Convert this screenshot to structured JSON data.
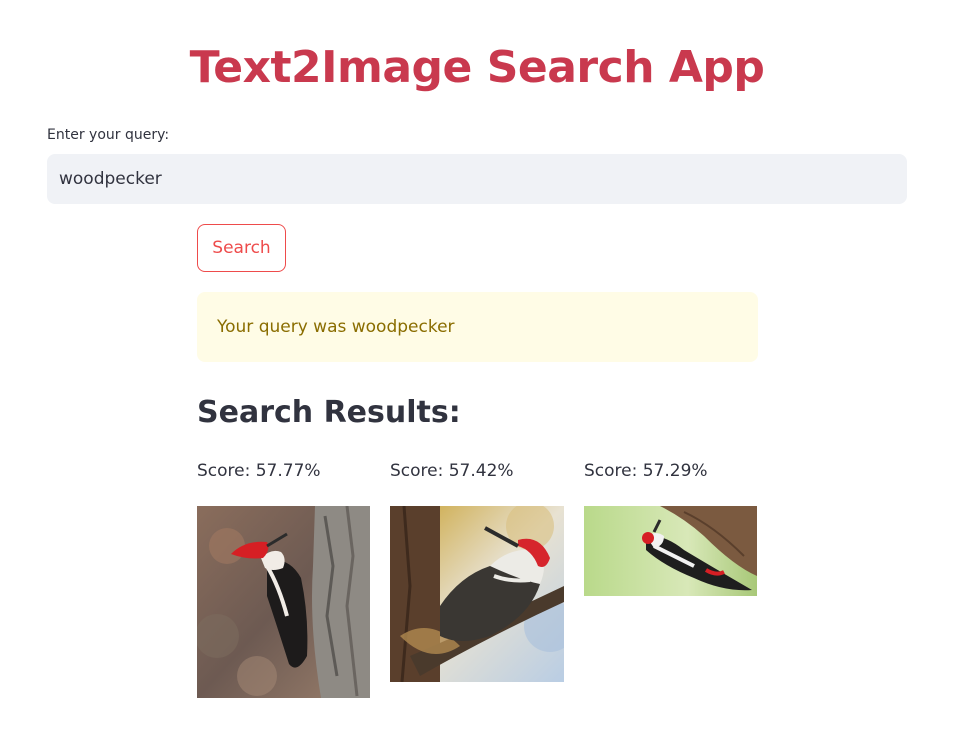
{
  "app": {
    "title": "Text2Image Search App"
  },
  "query": {
    "label": "Enter your query:",
    "value": "woodpecker"
  },
  "search": {
    "button_label": "Search"
  },
  "alert": {
    "message": "Your query was woodpecker"
  },
  "results": {
    "heading": "Search Results:",
    "items": [
      {
        "score": "Score: 57.77%",
        "image_name": "pileated-woodpecker-photo"
      },
      {
        "score": "Score: 57.42%",
        "image_name": "pileated-woodpecker-closeup-photo"
      },
      {
        "score": "Score: 57.29%",
        "image_name": "spotted-woodpecker-photo"
      }
    ]
  },
  "colors": {
    "title": "#c9394e",
    "button_accent": "#ee4b4b",
    "alert_bg": "#fffce6",
    "alert_text": "#8a6d00",
    "input_bg": "#f0f2f6"
  }
}
